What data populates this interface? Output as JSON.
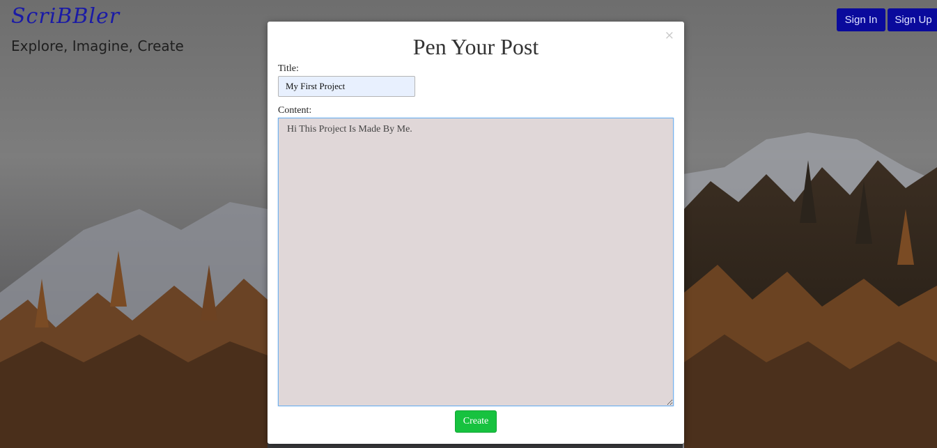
{
  "brand": {
    "logo_text": "ScriBBler",
    "tagline": "Explore, Imagine, Create"
  },
  "nav": {
    "sign_in_label": "Sign In",
    "sign_up_label": "Sign Up"
  },
  "modal": {
    "title": "Pen Your Post",
    "close_symbol": "×",
    "title_label": "Title:",
    "title_value": "My First Project",
    "content_label": "Content:",
    "content_value": "Hi This Project Is Made By Me.",
    "create_label": "Create"
  },
  "colors": {
    "brand_text": "#1a1aa6",
    "nav_button": "#0a0a9c",
    "create_button": "#17c23f",
    "content_bg": "#e0d7d8",
    "title_input_bg": "#e8f0fe"
  },
  "icons": {
    "close": "close-icon",
    "resize": "resize-handle-icon"
  }
}
